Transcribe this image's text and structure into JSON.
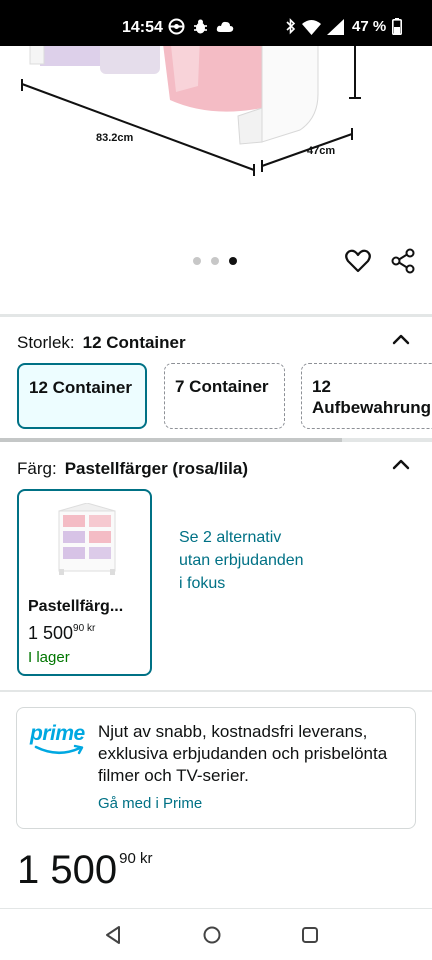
{
  "status_bar": {
    "time": "14:54",
    "battery": "47 %"
  },
  "product_image": {
    "width_label": "83.2cm",
    "depth_label": "47cm"
  },
  "carousel": {
    "pages": 3,
    "active_index": 3
  },
  "size_section": {
    "label": "Storlek:",
    "selected_value": "12 Container",
    "options": [
      {
        "line1": "12 Container",
        "line2": "",
        "selected": true
      },
      {
        "line1": "7 Container",
        "line2": "",
        "selected": false
      },
      {
        "line1": "12",
        "line2": "Aufbewahrung",
        "selected": false
      }
    ]
  },
  "color_section": {
    "label": "Färg:",
    "selected_value": "Pastellfärger (rosa/lila)",
    "card": {
      "name": "Pastellfärg...",
      "price": "1 500",
      "price_cents": "90 kr",
      "stock": "I lager"
    },
    "see_more": "Se 2 alternativ utan erbjudanden i fokus"
  },
  "prime": {
    "logo": "prime",
    "text": "Njut av snabb, kostnadsfri leverans, exklusiva erbjudanden och prisbelönta filmer och TV-serier.",
    "link": "Gå med i Prime"
  },
  "price": {
    "main": "1 500",
    "cents": "90 kr"
  },
  "colors": {
    "accent": "#007185",
    "stock": "#007600",
    "prime_blue": "#00a8e1"
  },
  "icons": [
    "heart-icon",
    "share-icon",
    "chevron-up-icon",
    "back-icon",
    "home-icon",
    "recents-icon"
  ]
}
